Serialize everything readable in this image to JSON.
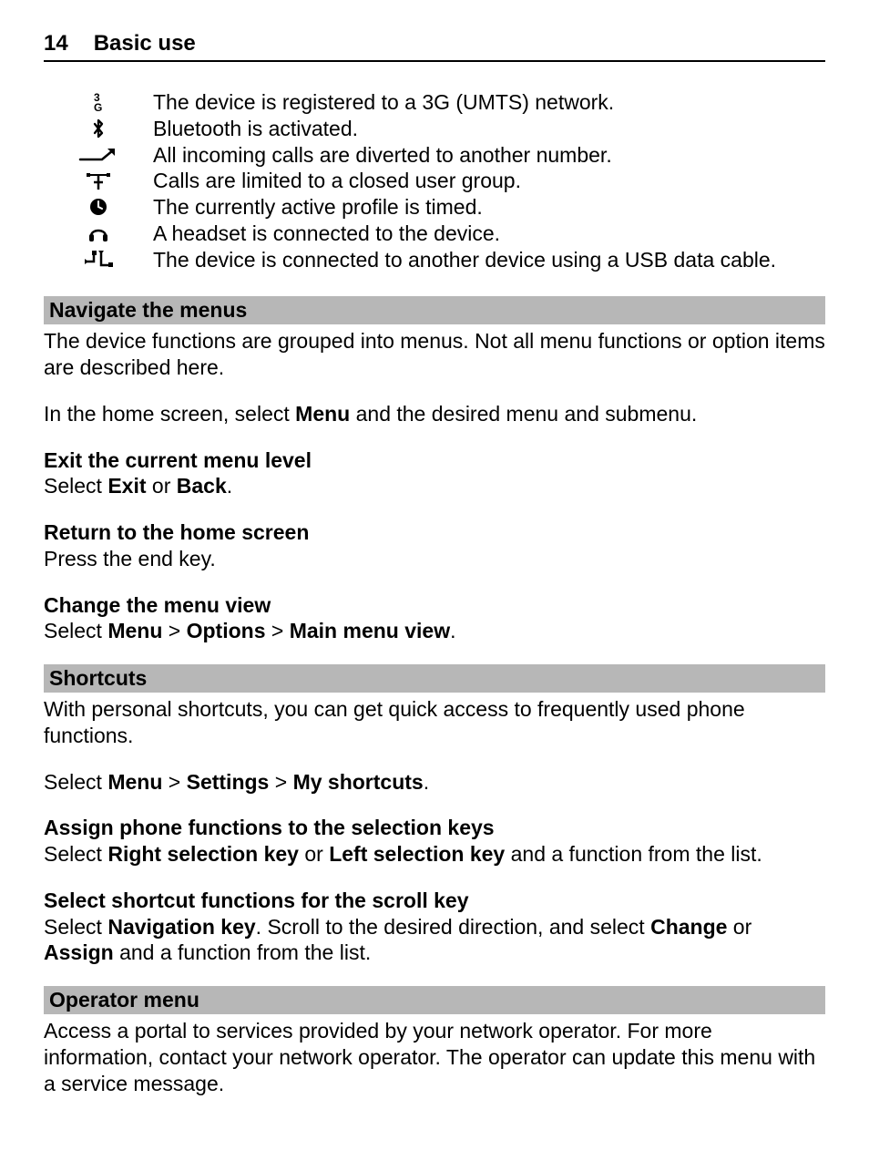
{
  "header": {
    "page_number": "14",
    "title": "Basic use"
  },
  "icons": [
    {
      "name": "3g",
      "desc": "The device is registered to a 3G (UMTS) network."
    },
    {
      "name": "bluetooth",
      "desc": "Bluetooth is activated."
    },
    {
      "name": "divert",
      "desc": "All incoming calls are diverted to another number."
    },
    {
      "name": "cug",
      "desc": "Calls are limited to a closed user group."
    },
    {
      "name": "timed",
      "desc": "The currently active profile is timed."
    },
    {
      "name": "headset",
      "desc": "A headset is connected to the device."
    },
    {
      "name": "usb",
      "desc": "The device is connected to another device using a USB data cable."
    }
  ],
  "nav_menus": {
    "title": "Navigate the menus",
    "p1": "The device functions are grouped into menus. Not all menu functions or option items are described here.",
    "p2_pre": "In the home screen, select ",
    "p2_b1": "Menu",
    "p2_post": " and the desired menu and submenu.",
    "h_exit": "Exit the current menu level",
    "exit_pre": "Select ",
    "exit_b1": "Exit",
    "exit_mid": " or ",
    "exit_b2": "Back",
    "exit_post": ".",
    "h_return": "Return to the home screen",
    "return_p": "Press the end key.",
    "h_change": "Change the menu view",
    "change_pre": "Select ",
    "change_b1": "Menu",
    "change_s1": "  > ",
    "change_b2": "Options",
    "change_s2": "  > ",
    "change_b3": "Main menu view",
    "change_post": "."
  },
  "shortcuts": {
    "title": "Shortcuts",
    "p1": "With personal shortcuts, you can get quick access to frequently used phone functions.",
    "p2_pre": "Select ",
    "p2_b1": "Menu",
    "p2_s1": "  > ",
    "p2_b2": "Settings",
    "p2_s2": "  > ",
    "p2_b3": "My shortcuts",
    "p2_post": ".",
    "h_assign": "Assign phone functions to the selection keys",
    "assign_pre": "Select ",
    "assign_b1": "Right selection key",
    "assign_mid": " or ",
    "assign_b2": "Left selection key",
    "assign_post": " and a function from the list.",
    "h_scroll": "Select shortcut functions for the scroll key",
    "scroll_pre": "Select ",
    "scroll_b1": "Navigation key",
    "scroll_mid1": ". Scroll to the desired direction, and select ",
    "scroll_b2": "Change",
    "scroll_mid2": " or ",
    "scroll_b3": "Assign",
    "scroll_post": " and a function from the list."
  },
  "operator": {
    "title": "Operator menu",
    "p1": "Access a portal to services provided by your network operator. For more information, contact your network operator. The operator can update this menu with a service message."
  }
}
